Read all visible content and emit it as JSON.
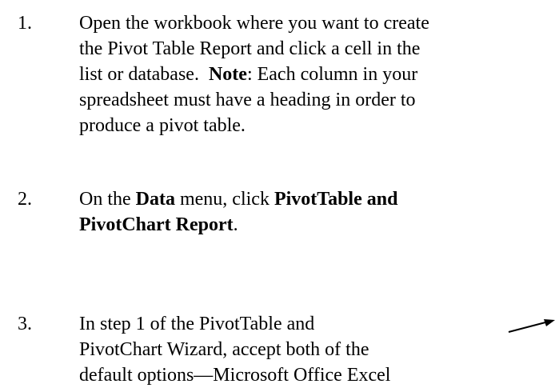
{
  "steps": [
    {
      "number": "1.",
      "lines": [
        {
          "parts": [
            {
              "text": "Open the workbook where you want to create",
              "bold": false
            }
          ]
        },
        {
          "parts": [
            {
              "text": "the Pivot Table Report and click a cell in the",
              "bold": false
            }
          ]
        },
        {
          "parts": [
            {
              "text": "list or database.  ",
              "bold": false
            },
            {
              "text": "Note",
              "bold": true
            },
            {
              "text": ": Each column in your",
              "bold": false
            }
          ]
        },
        {
          "parts": [
            {
              "text": "spreadsheet must have a heading in order to",
              "bold": false
            }
          ]
        },
        {
          "parts": [
            {
              "text": "produce a pivot table.",
              "bold": false
            }
          ]
        }
      ]
    },
    {
      "number": "2.",
      "lines": [
        {
          "parts": [
            {
              "text": "On the ",
              "bold": false
            },
            {
              "text": "Data",
              "bold": true
            },
            {
              "text": " menu, click ",
              "bold": false
            },
            {
              "text": "PivotTable and",
              "bold": true
            }
          ]
        },
        {
          "parts": [
            {
              "text": "PivotChart Report",
              "bold": true
            },
            {
              "text": ".",
              "bold": false
            }
          ]
        }
      ]
    },
    {
      "number": "3.",
      "lines": [
        {
          "parts": [
            {
              "text": "In step 1 of the PivotTable and",
              "bold": false
            }
          ]
        },
        {
          "parts": [
            {
              "text": "PivotChart Wizard, accept both of the",
              "bold": false
            }
          ]
        },
        {
          "parts": [
            {
              "text": "default options—Microsoft Office Excel",
              "bold": false
            }
          ]
        }
      ]
    }
  ],
  "annotation": {
    "icon": "arrow-icon",
    "color": "#000000"
  }
}
